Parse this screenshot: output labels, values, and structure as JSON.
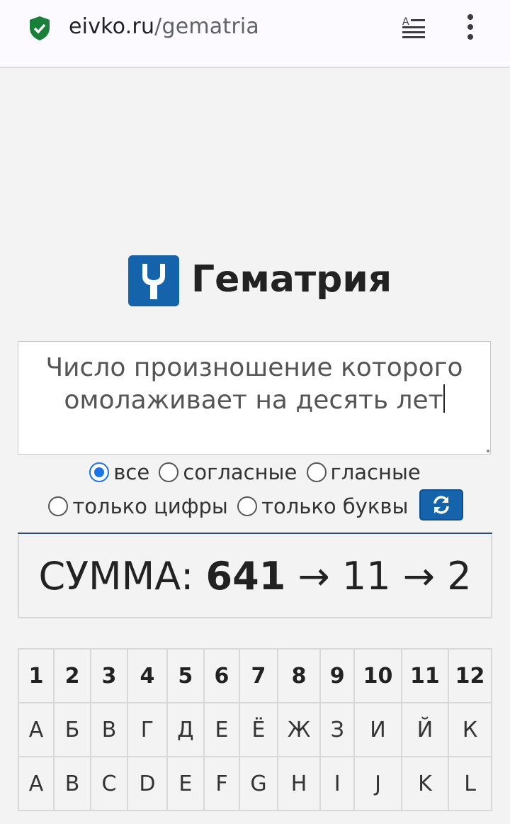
{
  "browser": {
    "url_domain": "eivko.ru",
    "url_path": "/gematria",
    "secure_icon": "shield-check-icon",
    "reader_icon": "reader-mode-icon",
    "menu_icon": "more-vert-icon",
    "secure_color": "#188038"
  },
  "header": {
    "logo_icon": "tuning-fork-icon",
    "logo_color": "#1463ab",
    "title": "Гематрия"
  },
  "input": {
    "value": "Число произношение которого омолаживает на десять лет"
  },
  "options": {
    "selected": "все",
    "items": [
      {
        "label": "все",
        "checked": true
      },
      {
        "label": "согласные",
        "checked": false
      },
      {
        "label": "гласные",
        "checked": false
      },
      {
        "label": "только цифры",
        "checked": false
      },
      {
        "label": "только буквы",
        "checked": false
      }
    ],
    "refresh_icon": "refresh-icon"
  },
  "result": {
    "label": "СУММА:",
    "sum": "641",
    "arrow": "→",
    "reduced1": "11",
    "reduced2": "2"
  },
  "alphabet_table": {
    "numbers": [
      "1",
      "2",
      "3",
      "4",
      "5",
      "6",
      "7",
      "8",
      "9",
      "10",
      "11",
      "12"
    ],
    "cyrillic": [
      "А",
      "Б",
      "В",
      "Г",
      "Д",
      "Е",
      "Ё",
      "Ж",
      "З",
      "И",
      "Й",
      "К"
    ],
    "latin": [
      "A",
      "B",
      "C",
      "D",
      "E",
      "F",
      "G",
      "H",
      "I",
      "J",
      "K",
      "L"
    ]
  }
}
